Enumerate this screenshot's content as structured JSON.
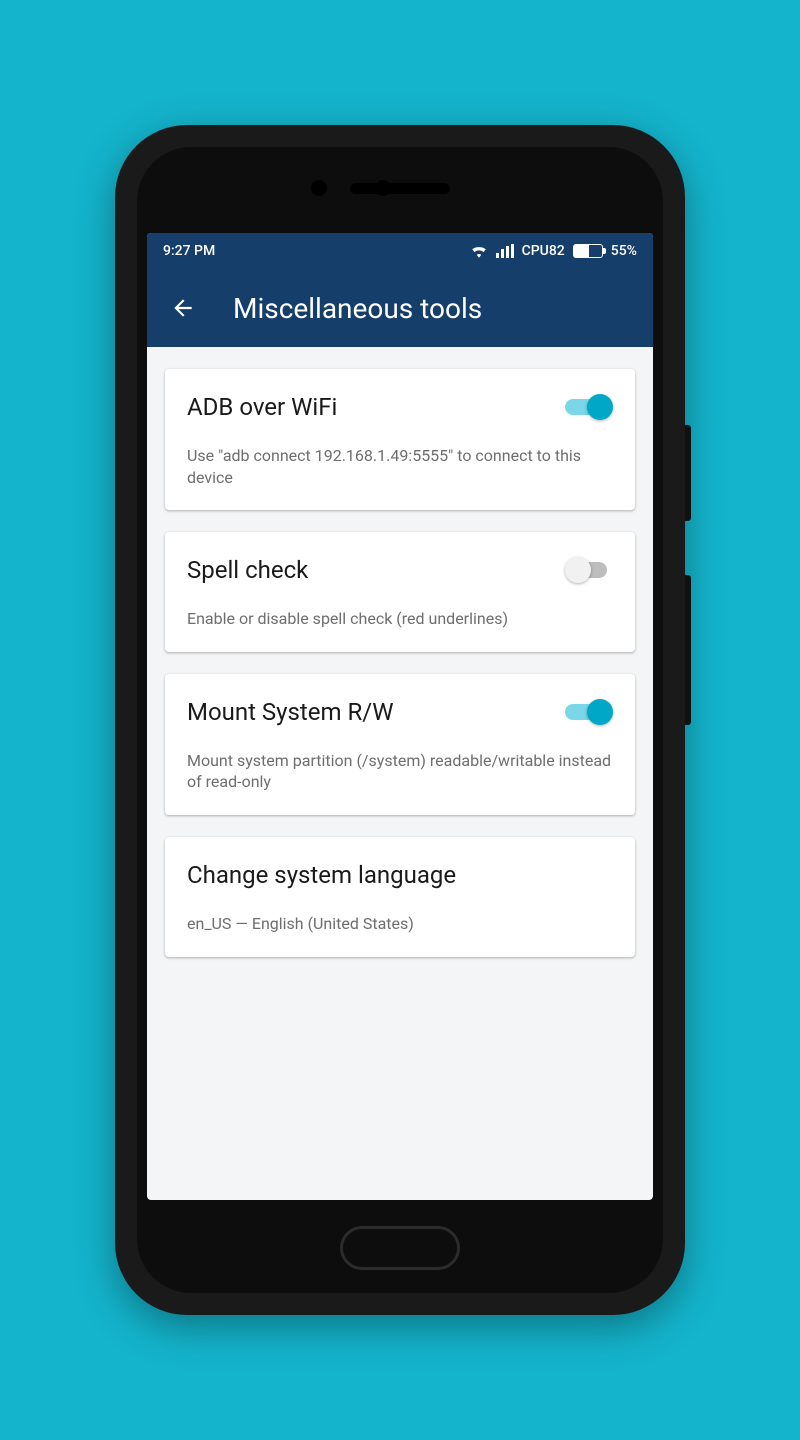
{
  "statusbar": {
    "time": "9:27 PM",
    "cpu": "CPU82",
    "battery_pct": "55%"
  },
  "appbar": {
    "title": "Miscellaneous tools"
  },
  "cards": {
    "adb": {
      "title": "ADB over WiFi",
      "desc": "Use \"adb connect 192.168.1.49:5555\" to connect to this device",
      "on": true
    },
    "spell": {
      "title": "Spell check",
      "desc": "Enable or disable spell check (red underlines)",
      "on": false
    },
    "mount": {
      "title": "Mount System R/W",
      "desc": "Mount system partition (/system) readable/writable instead of read-only",
      "on": true
    },
    "lang": {
      "title": "Change system language",
      "desc": "en_US — English (United States)"
    }
  },
  "colors": {
    "bg": "#14b4cc",
    "primary": "#153e6b",
    "accent": "#00a7c7"
  }
}
